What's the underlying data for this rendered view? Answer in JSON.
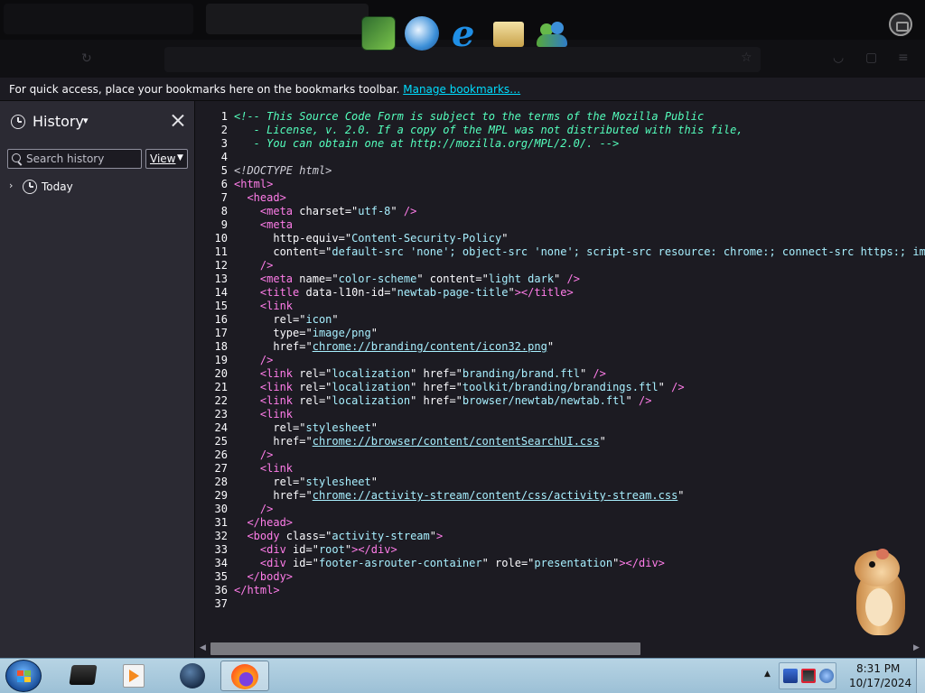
{
  "bookmarks_bar": {
    "message": "For quick access, place your bookmarks here on the bookmarks toolbar.",
    "manage_link": "Manage bookmarks…"
  },
  "sidebar": {
    "title": "History",
    "search_placeholder": "Search history",
    "view_button": "View",
    "tree": [
      {
        "label": "Today",
        "icon": "clock-icon",
        "expanded": false
      }
    ]
  },
  "source_view": {
    "lines": [
      [
        {
          "t": "comment",
          "v": "<!-- This Source Code Form is subject to the terms of the Mozilla Public"
        }
      ],
      [
        {
          "t": "comment",
          "v": "   - License, v. 2.0. If a copy of the MPL was not distributed with this file,"
        }
      ],
      [
        {
          "t": "comment",
          "v": "   - You can obtain one at http://mozilla.org/MPL/2.0/. -->"
        }
      ],
      [],
      [
        {
          "t": "doctype",
          "v": "<!DOCTYPE html>"
        }
      ],
      [
        {
          "t": "tag",
          "v": "<html"
        },
        {
          "t": "tag",
          "v": ">"
        }
      ],
      [
        {
          "t": "plain",
          "v": "  "
        },
        {
          "t": "tag",
          "v": "<head>"
        }
      ],
      [
        {
          "t": "plain",
          "v": "    "
        },
        {
          "t": "tag",
          "v": "<meta"
        },
        {
          "t": "attr",
          "v": " charset"
        },
        {
          "t": "plain",
          "v": "=\""
        },
        {
          "t": "val",
          "v": "utf-8"
        },
        {
          "t": "plain",
          "v": "\" "
        },
        {
          "t": "tag",
          "v": "/>"
        }
      ],
      [
        {
          "t": "plain",
          "v": "    "
        },
        {
          "t": "tag",
          "v": "<meta"
        }
      ],
      [
        {
          "t": "plain",
          "v": "      "
        },
        {
          "t": "attr",
          "v": "http-equiv"
        },
        {
          "t": "plain",
          "v": "=\""
        },
        {
          "t": "val",
          "v": "Content-Security-Policy"
        },
        {
          "t": "plain",
          "v": "\""
        }
      ],
      [
        {
          "t": "plain",
          "v": "      "
        },
        {
          "t": "attr",
          "v": "content"
        },
        {
          "t": "plain",
          "v": "=\""
        },
        {
          "t": "val",
          "v": "default-src 'none'; object-src 'none'; script-src resource: chrome:; connect-src https:; img-sr"
        }
      ],
      [
        {
          "t": "plain",
          "v": "    "
        },
        {
          "t": "tag",
          "v": "/>"
        }
      ],
      [
        {
          "t": "plain",
          "v": "    "
        },
        {
          "t": "tag",
          "v": "<meta"
        },
        {
          "t": "attr",
          "v": " name"
        },
        {
          "t": "plain",
          "v": "=\""
        },
        {
          "t": "val",
          "v": "color-scheme"
        },
        {
          "t": "plain",
          "v": "\""
        },
        {
          "t": "attr",
          "v": " content"
        },
        {
          "t": "plain",
          "v": "=\""
        },
        {
          "t": "val",
          "v": "light dark"
        },
        {
          "t": "plain",
          "v": "\" "
        },
        {
          "t": "tag",
          "v": "/>"
        }
      ],
      [
        {
          "t": "plain",
          "v": "    "
        },
        {
          "t": "tag",
          "v": "<title"
        },
        {
          "t": "attr",
          "v": " data-l10n-id"
        },
        {
          "t": "plain",
          "v": "=\""
        },
        {
          "t": "val",
          "v": "newtab-page-title"
        },
        {
          "t": "plain",
          "v": "\""
        },
        {
          "t": "tag",
          "v": "></title>"
        }
      ],
      [
        {
          "t": "plain",
          "v": "    "
        },
        {
          "t": "tag",
          "v": "<link"
        }
      ],
      [
        {
          "t": "plain",
          "v": "      "
        },
        {
          "t": "attr",
          "v": "rel"
        },
        {
          "t": "plain",
          "v": "=\""
        },
        {
          "t": "val",
          "v": "icon"
        },
        {
          "t": "plain",
          "v": "\""
        }
      ],
      [
        {
          "t": "plain",
          "v": "      "
        },
        {
          "t": "attr",
          "v": "type"
        },
        {
          "t": "plain",
          "v": "=\""
        },
        {
          "t": "val",
          "v": "image/png"
        },
        {
          "t": "plain",
          "v": "\""
        }
      ],
      [
        {
          "t": "plain",
          "v": "      "
        },
        {
          "t": "attr",
          "v": "href"
        },
        {
          "t": "plain",
          "v": "=\""
        },
        {
          "t": "link",
          "v": "chrome://branding/content/icon32.png"
        },
        {
          "t": "plain",
          "v": "\""
        }
      ],
      [
        {
          "t": "plain",
          "v": "    "
        },
        {
          "t": "tag",
          "v": "/>"
        }
      ],
      [
        {
          "t": "plain",
          "v": "    "
        },
        {
          "t": "tag",
          "v": "<link"
        },
        {
          "t": "attr",
          "v": " rel"
        },
        {
          "t": "plain",
          "v": "=\""
        },
        {
          "t": "val",
          "v": "localization"
        },
        {
          "t": "plain",
          "v": "\""
        },
        {
          "t": "attr",
          "v": " href"
        },
        {
          "t": "plain",
          "v": "=\""
        },
        {
          "t": "val",
          "v": "branding/brand.ftl"
        },
        {
          "t": "plain",
          "v": "\" "
        },
        {
          "t": "tag",
          "v": "/>"
        }
      ],
      [
        {
          "t": "plain",
          "v": "    "
        },
        {
          "t": "tag",
          "v": "<link"
        },
        {
          "t": "attr",
          "v": " rel"
        },
        {
          "t": "plain",
          "v": "=\""
        },
        {
          "t": "val",
          "v": "localization"
        },
        {
          "t": "plain",
          "v": "\""
        },
        {
          "t": "attr",
          "v": " href"
        },
        {
          "t": "plain",
          "v": "=\""
        },
        {
          "t": "val",
          "v": "toolkit/branding/brandings.ftl"
        },
        {
          "t": "plain",
          "v": "\" "
        },
        {
          "t": "tag",
          "v": "/>"
        }
      ],
      [
        {
          "t": "plain",
          "v": "    "
        },
        {
          "t": "tag",
          "v": "<link"
        },
        {
          "t": "attr",
          "v": " rel"
        },
        {
          "t": "plain",
          "v": "=\""
        },
        {
          "t": "val",
          "v": "localization"
        },
        {
          "t": "plain",
          "v": "\""
        },
        {
          "t": "attr",
          "v": " href"
        },
        {
          "t": "plain",
          "v": "=\""
        },
        {
          "t": "val",
          "v": "browser/newtab/newtab.ftl"
        },
        {
          "t": "plain",
          "v": "\" "
        },
        {
          "t": "tag",
          "v": "/>"
        }
      ],
      [
        {
          "t": "plain",
          "v": "    "
        },
        {
          "t": "tag",
          "v": "<link"
        }
      ],
      [
        {
          "t": "plain",
          "v": "      "
        },
        {
          "t": "attr",
          "v": "rel"
        },
        {
          "t": "plain",
          "v": "=\""
        },
        {
          "t": "val",
          "v": "stylesheet"
        },
        {
          "t": "plain",
          "v": "\""
        }
      ],
      [
        {
          "t": "plain",
          "v": "      "
        },
        {
          "t": "attr",
          "v": "href"
        },
        {
          "t": "plain",
          "v": "=\""
        },
        {
          "t": "link",
          "v": "chrome://browser/content/contentSearchUI.css"
        },
        {
          "t": "plain",
          "v": "\""
        }
      ],
      [
        {
          "t": "plain",
          "v": "    "
        },
        {
          "t": "tag",
          "v": "/>"
        }
      ],
      [
        {
          "t": "plain",
          "v": "    "
        },
        {
          "t": "tag",
          "v": "<link"
        }
      ],
      [
        {
          "t": "plain",
          "v": "      "
        },
        {
          "t": "attr",
          "v": "rel"
        },
        {
          "t": "plain",
          "v": "=\""
        },
        {
          "t": "val",
          "v": "stylesheet"
        },
        {
          "t": "plain",
          "v": "\""
        }
      ],
      [
        {
          "t": "plain",
          "v": "      "
        },
        {
          "t": "attr",
          "v": "href"
        },
        {
          "t": "plain",
          "v": "=\""
        },
        {
          "t": "link",
          "v": "chrome://activity-stream/content/css/activity-stream.css"
        },
        {
          "t": "plain",
          "v": "\""
        }
      ],
      [
        {
          "t": "plain",
          "v": "    "
        },
        {
          "t": "tag",
          "v": "/>"
        }
      ],
      [
        {
          "t": "plain",
          "v": "  "
        },
        {
          "t": "tag",
          "v": "</head>"
        }
      ],
      [
        {
          "t": "plain",
          "v": "  "
        },
        {
          "t": "tag",
          "v": "<body"
        },
        {
          "t": "attr",
          "v": " class"
        },
        {
          "t": "plain",
          "v": "=\""
        },
        {
          "t": "val",
          "v": "activity-stream"
        },
        {
          "t": "plain",
          "v": "\""
        },
        {
          "t": "tag",
          "v": ">"
        }
      ],
      [
        {
          "t": "plain",
          "v": "    "
        },
        {
          "t": "tag",
          "v": "<div"
        },
        {
          "t": "attr",
          "v": " id"
        },
        {
          "t": "plain",
          "v": "=\""
        },
        {
          "t": "val",
          "v": "root"
        },
        {
          "t": "plain",
          "v": "\""
        },
        {
          "t": "tag",
          "v": "></div>"
        }
      ],
      [
        {
          "t": "plain",
          "v": "    "
        },
        {
          "t": "tag",
          "v": "<div"
        },
        {
          "t": "attr",
          "v": " id"
        },
        {
          "t": "plain",
          "v": "=\""
        },
        {
          "t": "val",
          "v": "footer-asrouter-container"
        },
        {
          "t": "plain",
          "v": "\""
        },
        {
          "t": "attr",
          "v": " role"
        },
        {
          "t": "plain",
          "v": "=\""
        },
        {
          "t": "val",
          "v": "presentation"
        },
        {
          "t": "plain",
          "v": "\""
        },
        {
          "t": "tag",
          "v": "></div>"
        }
      ],
      [
        {
          "t": "plain",
          "v": "  "
        },
        {
          "t": "tag",
          "v": "</body>"
        }
      ],
      [
        {
          "t": "tag",
          "v": "</html>"
        }
      ],
      []
    ]
  },
  "taskbar": {
    "items": [
      {
        "name": "display-app",
        "active": false
      },
      {
        "name": "media-player",
        "active": false
      },
      {
        "name": "globe-app",
        "active": false
      },
      {
        "name": "firefox",
        "active": true
      }
    ],
    "clock_time": "8:31 PM",
    "clock_date": "10/17/2024"
  },
  "colors": {
    "code_bg": "#1c1b22",
    "sidebar_bg": "#2b2a33",
    "comment": "#54ffbd",
    "tag": "#ff7de9",
    "value": "#a8f0ff",
    "link": "#00ddff"
  }
}
